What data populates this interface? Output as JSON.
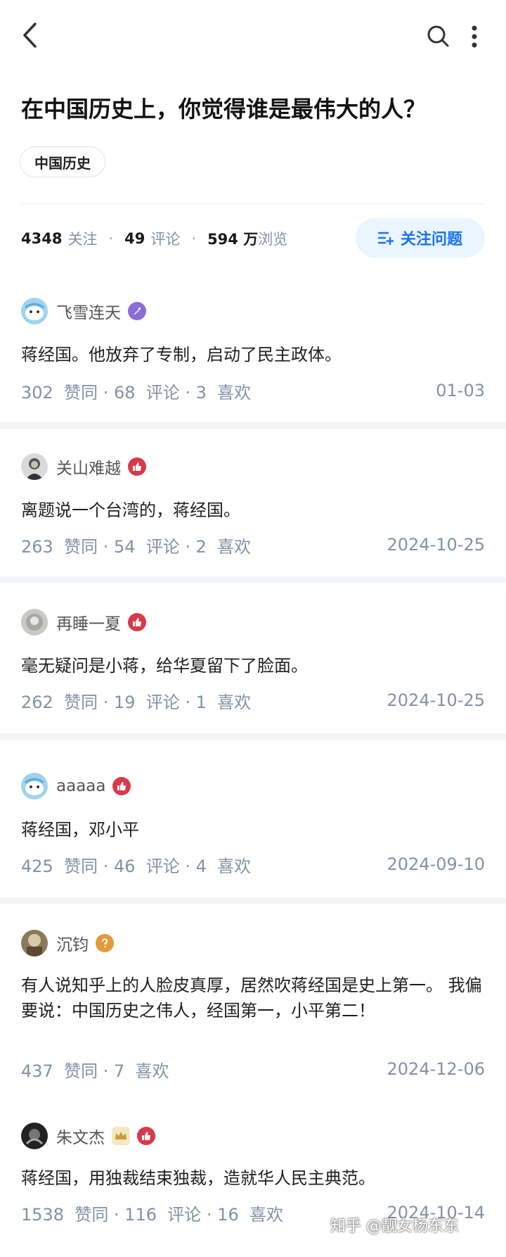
{
  "question": {
    "title": "在中国历史上，你觉得谁是最伟大的人？",
    "topic": "中国历史"
  },
  "stats": {
    "followers_num": "4348",
    "followers_label": "关注",
    "comments_num": "49",
    "comments_label": "评论",
    "views_num": "594 万",
    "views_label": "浏览",
    "separator": "·"
  },
  "follow_button": {
    "label": "关注问题"
  },
  "answers": [
    {
      "author": "飞雪连天",
      "badge_color": "#8d6bd9",
      "content": "蒋经国。他放弃了专制，启动了民主政体。",
      "meta": "302  赞同 · 68  评论 · 3  喜欢",
      "date": "01-03"
    },
    {
      "author": "关山难越",
      "badge_color": "#d9394a",
      "content": "离题说一个台湾的，蒋经国。",
      "meta": "263  赞同 · 54  评论 · 2  喜欢",
      "date": "2024-10-25"
    },
    {
      "author": "再睡一夏",
      "badge_color": "#d9394a",
      "content": "毫无疑问是小蒋，给华夏留下了脸面。",
      "meta": "262  赞同 · 19  评论 · 1  喜欢",
      "date": "2024-10-25"
    },
    {
      "author": "aaaaa",
      "badge_color": "#d9394a",
      "content": "蒋经国，邓小平",
      "meta": "425  赞同 · 46  评论 · 4  喜欢",
      "date": "2024-09-10"
    },
    {
      "author": "沉钧",
      "badge_color": "#e59a3a",
      "content": "有人说知乎上的人脸皮真厚，居然吹蒋经国是史上第一。 我偏要说：中国历史之伟人，经国第一，小平第二！",
      "meta": "437  赞同 · 7  喜欢",
      "date": "2024-12-06"
    },
    {
      "author": "朱文杰",
      "badge_color": "#d9394a",
      "content": "蒋经国，用独裁结束独裁，造就华人民主典范。",
      "meta": "1538  赞同 · 116  评论 · 16  喜欢",
      "date": "2024-10-14"
    }
  ],
  "watermark": "知乎 @靓女杨东东",
  "icons": {
    "back": "chevron-left-icon",
    "search": "search-icon",
    "more": "more-vertical-icon",
    "follow": "add-list-icon"
  },
  "colors": {
    "accent": "#1772f6",
    "accent_bg": "#ebf5ff",
    "meta_gray": "#8590a6"
  }
}
